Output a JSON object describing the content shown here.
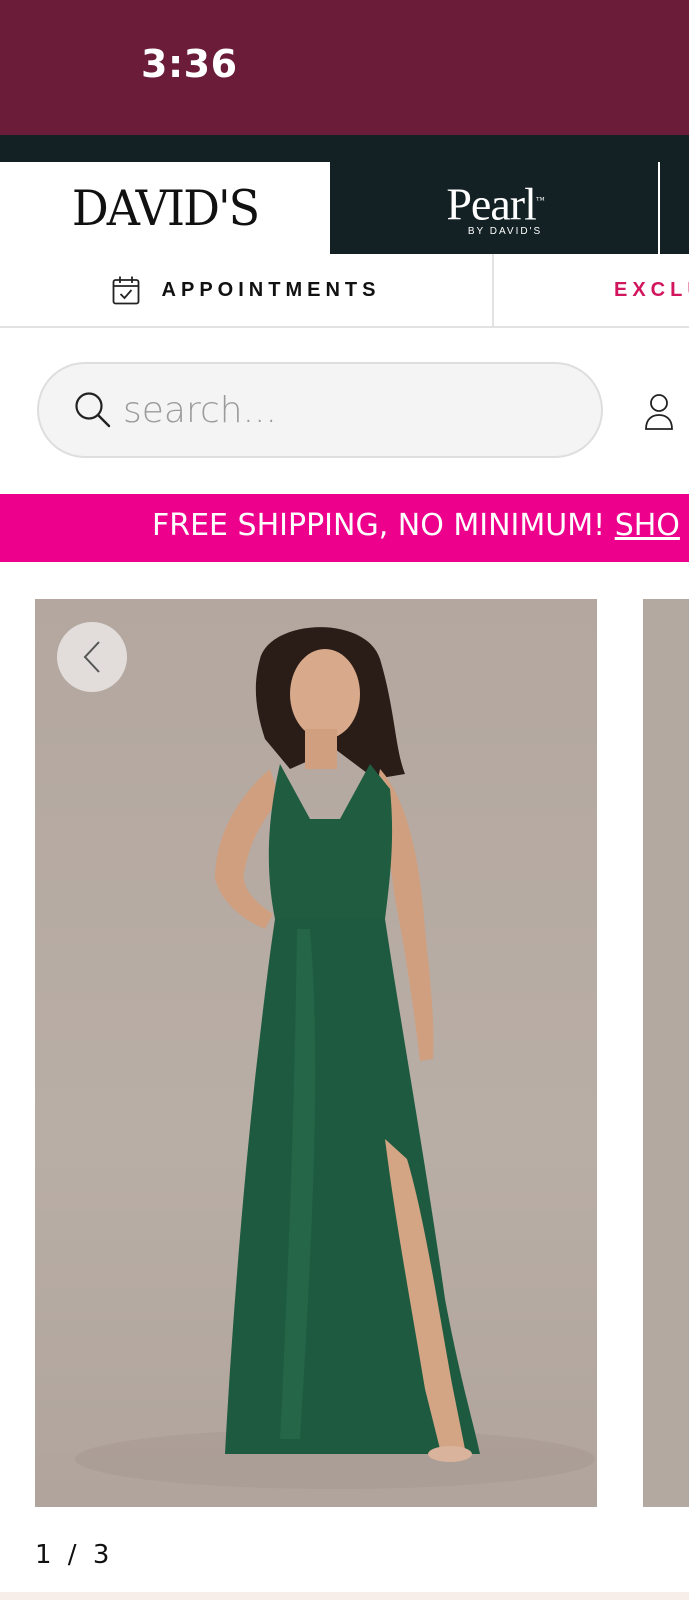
{
  "status_bar": {
    "time": "3:36",
    "background": "#6a1c38"
  },
  "brand_tabs": {
    "davids": "DAVID'S",
    "pearl": "Pearl",
    "pearl_trademark": "™",
    "pearl_sub": "BY DAVID'S"
  },
  "nav": {
    "appointments_icon": "calendar-check-icon",
    "appointments_label": "APPOINTMENTS",
    "exclusive_label": "EXCLU"
  },
  "search": {
    "placeholder": "search...",
    "icon": "search-icon",
    "account_icon": "user-icon"
  },
  "promo": {
    "text": "FREE SHIPPING, NO MINIMUM! ",
    "link": "SHO",
    "background": "#ec008c"
  },
  "gallery": {
    "prev_icon": "chevron-left-icon",
    "image_alt": "Model in green satin halter gown with side slit",
    "indicator": "1 / 3",
    "dress_color": "#1e5a3f"
  }
}
